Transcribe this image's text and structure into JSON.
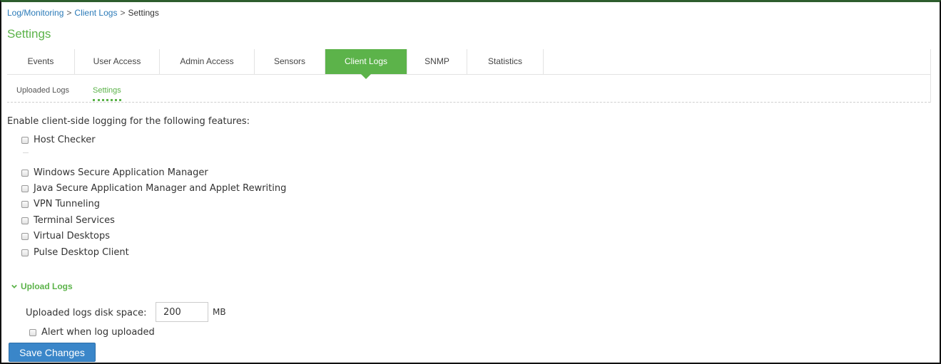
{
  "breadcrumb": {
    "item1": "Log/Monitoring",
    "sep": ">",
    "item2": "Client Logs",
    "current": "Settings"
  },
  "page_title": "Settings",
  "tabs": [
    {
      "label": "Events"
    },
    {
      "label": "User Access"
    },
    {
      "label": "Admin Access"
    },
    {
      "label": "Sensors"
    },
    {
      "label": "Client Logs",
      "active": true
    },
    {
      "label": "SNMP"
    },
    {
      "label": "Statistics"
    }
  ],
  "subtabs": [
    {
      "label": "Uploaded Logs"
    },
    {
      "label": "Settings",
      "active": true
    }
  ],
  "intro_text": "Enable client-side logging for the following features:",
  "features": [
    {
      "label": "Host Checker",
      "checked": false
    },
    {
      "label": "Windows Secure Application Manager",
      "checked": false
    },
    {
      "label": "Java Secure Application Manager and Applet Rewriting",
      "checked": false
    },
    {
      "label": "VPN Tunneling",
      "checked": false
    },
    {
      "label": "Terminal Services",
      "checked": false
    },
    {
      "label": "Virtual Desktops",
      "checked": false
    },
    {
      "label": "Pulse Desktop Client",
      "checked": false
    }
  ],
  "upload_logs": {
    "section_title": "Upload Logs",
    "disk_space_label": "Uploaded logs disk space:",
    "disk_space_value": "200",
    "unit": "MB",
    "alert_label": "Alert when log uploaded",
    "alert_checked": false
  },
  "save_label": "Save Changes",
  "colors": {
    "accent": "#5cb34a",
    "link": "#2a7ab8",
    "button": "#3a86c9"
  },
  "icons": {
    "section_chevron": "chevron-down-icon"
  }
}
